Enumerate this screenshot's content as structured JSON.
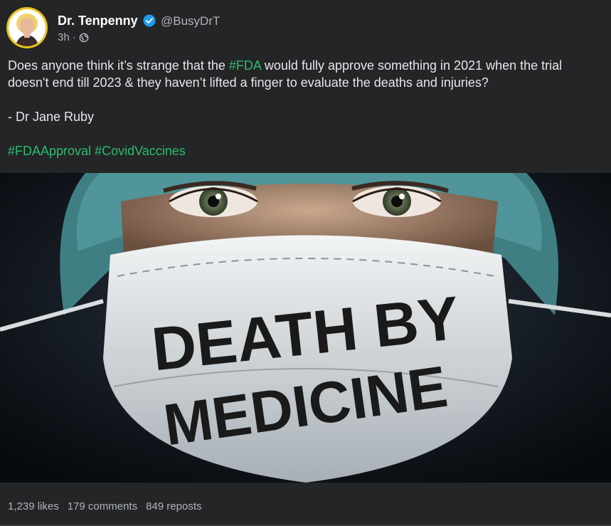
{
  "author": {
    "name": "Dr. Tenpenny",
    "handle": "@BusyDrT",
    "time": "3h",
    "separator": "·",
    "verified_color": "#1d9bf0",
    "avatar_ring_color": "#e8c21a"
  },
  "post": {
    "text_before": "Does anyone think it’s strange that the ",
    "tag_fda": "#FDA",
    "text_after": " would fully approve something in 2021 when the trial doesn't end till 2023 & they haven’t lifted a finger to evaluate the deaths and injuries?",
    "attribution": "- Dr Jane Ruby",
    "hashtags": [
      "#FDAApproval",
      "#CovidVaccines"
    ],
    "hashtag_color": "#2bbd6e"
  },
  "image": {
    "headline_line1": "DEATH BY",
    "headline_line2": "MEDICINE"
  },
  "stats": {
    "likes": "1,239 likes",
    "comments": "179 comments",
    "reposts": "849 reposts"
  }
}
